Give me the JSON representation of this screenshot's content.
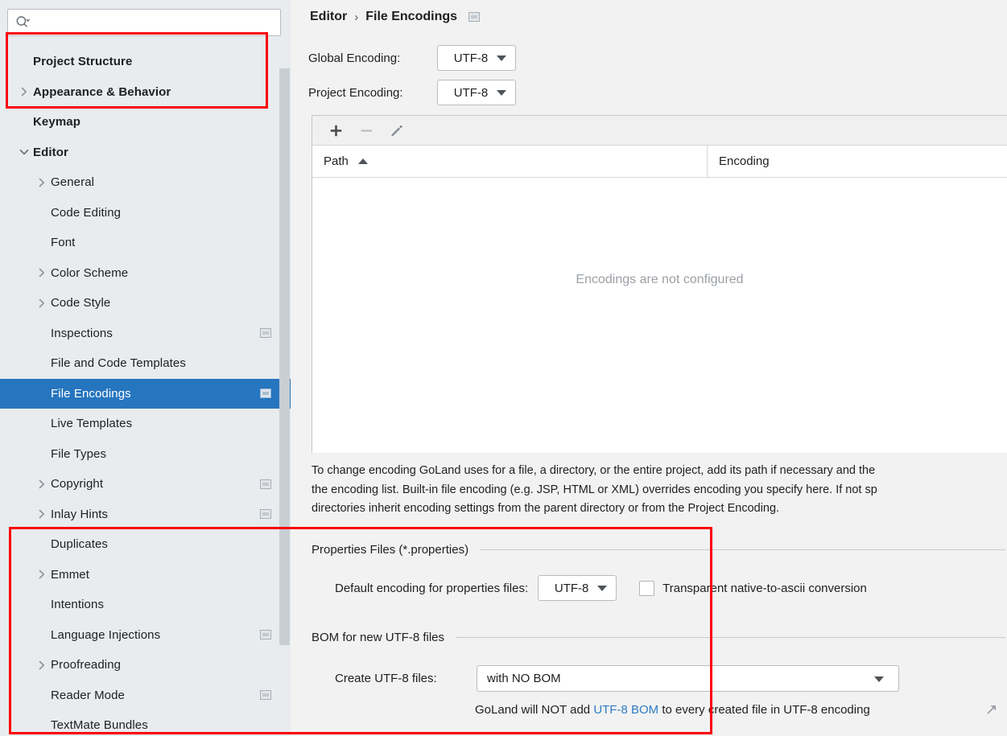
{
  "colors": {
    "selection": "#2675bf",
    "annotation": "#fb0007",
    "sidebar_bg": "#e8ecef",
    "main_bg": "#f2f2f2",
    "link": "#2e7cc4",
    "placeholder_text": "#9ba0a6"
  },
  "sidebar": {
    "search": {
      "value": "",
      "placeholder": ""
    },
    "items": [
      {
        "label": "Project Structure",
        "depth": 1,
        "arrow": "none",
        "bold": true,
        "panel_icon": false,
        "selected": false
      },
      {
        "label": "Appearance & Behavior",
        "depth": 1,
        "arrow": "right",
        "bold": true,
        "panel_icon": false,
        "selected": false
      },
      {
        "label": "Keymap",
        "depth": 1,
        "arrow": "none",
        "bold": true,
        "panel_icon": false,
        "selected": false
      },
      {
        "label": "Editor",
        "depth": 1,
        "arrow": "down",
        "bold": true,
        "panel_icon": false,
        "selected": false
      },
      {
        "label": "General",
        "depth": 2,
        "arrow": "right",
        "bold": false,
        "panel_icon": false,
        "selected": false
      },
      {
        "label": "Code Editing",
        "depth": 2,
        "arrow": "none",
        "bold": false,
        "panel_icon": false,
        "selected": false
      },
      {
        "label": "Font",
        "depth": 2,
        "arrow": "none",
        "bold": false,
        "panel_icon": false,
        "selected": false
      },
      {
        "label": "Color Scheme",
        "depth": 2,
        "arrow": "right",
        "bold": false,
        "panel_icon": false,
        "selected": false
      },
      {
        "label": "Code Style",
        "depth": 2,
        "arrow": "right",
        "bold": false,
        "panel_icon": false,
        "selected": false
      },
      {
        "label": "Inspections",
        "depth": 2,
        "arrow": "none",
        "bold": false,
        "panel_icon": true,
        "selected": false
      },
      {
        "label": "File and Code Templates",
        "depth": 2,
        "arrow": "none",
        "bold": false,
        "panel_icon": false,
        "selected": false
      },
      {
        "label": "File Encodings",
        "depth": 2,
        "arrow": "none",
        "bold": false,
        "panel_icon": true,
        "selected": true
      },
      {
        "label": "Live Templates",
        "depth": 2,
        "arrow": "none",
        "bold": false,
        "panel_icon": false,
        "selected": false
      },
      {
        "label": "File Types",
        "depth": 2,
        "arrow": "none",
        "bold": false,
        "panel_icon": false,
        "selected": false
      },
      {
        "label": "Copyright",
        "depth": 2,
        "arrow": "right",
        "bold": false,
        "panel_icon": true,
        "selected": false
      },
      {
        "label": "Inlay Hints",
        "depth": 2,
        "arrow": "right",
        "bold": false,
        "panel_icon": true,
        "selected": false
      },
      {
        "label": "Duplicates",
        "depth": 2,
        "arrow": "none",
        "bold": false,
        "panel_icon": false,
        "selected": false
      },
      {
        "label": "Emmet",
        "depth": 2,
        "arrow": "right",
        "bold": false,
        "panel_icon": false,
        "selected": false
      },
      {
        "label": "Intentions",
        "depth": 2,
        "arrow": "none",
        "bold": false,
        "panel_icon": false,
        "selected": false
      },
      {
        "label": "Language Injections",
        "depth": 2,
        "arrow": "none",
        "bold": false,
        "panel_icon": true,
        "selected": false
      },
      {
        "label": "Proofreading",
        "depth": 2,
        "arrow": "right",
        "bold": false,
        "panel_icon": false,
        "selected": false
      },
      {
        "label": "Reader Mode",
        "depth": 2,
        "arrow": "none",
        "bold": false,
        "panel_icon": true,
        "selected": false
      },
      {
        "label": "TextMate Bundles",
        "depth": 2,
        "arrow": "none",
        "bold": false,
        "panel_icon": false,
        "selected": false
      }
    ]
  },
  "breadcrumb": {
    "parent": "Editor",
    "separator": "›",
    "current": "File Encodings"
  },
  "encoding": {
    "global_label": "Global Encoding:",
    "global_value": "UTF-8",
    "project_label": "Project Encoding:",
    "project_value": "UTF-8"
  },
  "toolbar": {
    "add_title": "Add",
    "remove_title": "Remove",
    "edit_title": "Edit"
  },
  "table": {
    "columns": [
      "Path",
      "Encoding"
    ],
    "sort_column": "Path",
    "sort_direction": "asc",
    "rows": [],
    "empty_text": "Encodings are not configured"
  },
  "description": {
    "line1": "To change encoding GoLand uses for a file, a directory, or the entire project, add its path if necessary and the",
    "line2": "the encoding list. Built-in file encoding (e.g. JSP, HTML or XML) overrides encoding you specify here. If not sp",
    "line3": "directories inherit encoding settings from the parent directory or from the Project Encoding."
  },
  "properties_section": {
    "title": "Properties Files (*.properties)",
    "default_encoding_label": "Default encoding for properties files:",
    "default_encoding_value": "UTF-8",
    "transparent_checkbox_label": "Transparent native-to-ascii conversion",
    "transparent_checked": false
  },
  "bom_section": {
    "title": "BOM for new UTF-8 files",
    "create_label": "Create UTF-8 files:",
    "create_value": "with NO BOM",
    "note_prefix": "GoLand will NOT add ",
    "note_link": "UTF-8 BOM",
    "note_suffix": " to every created file in UTF-8 encoding"
  }
}
